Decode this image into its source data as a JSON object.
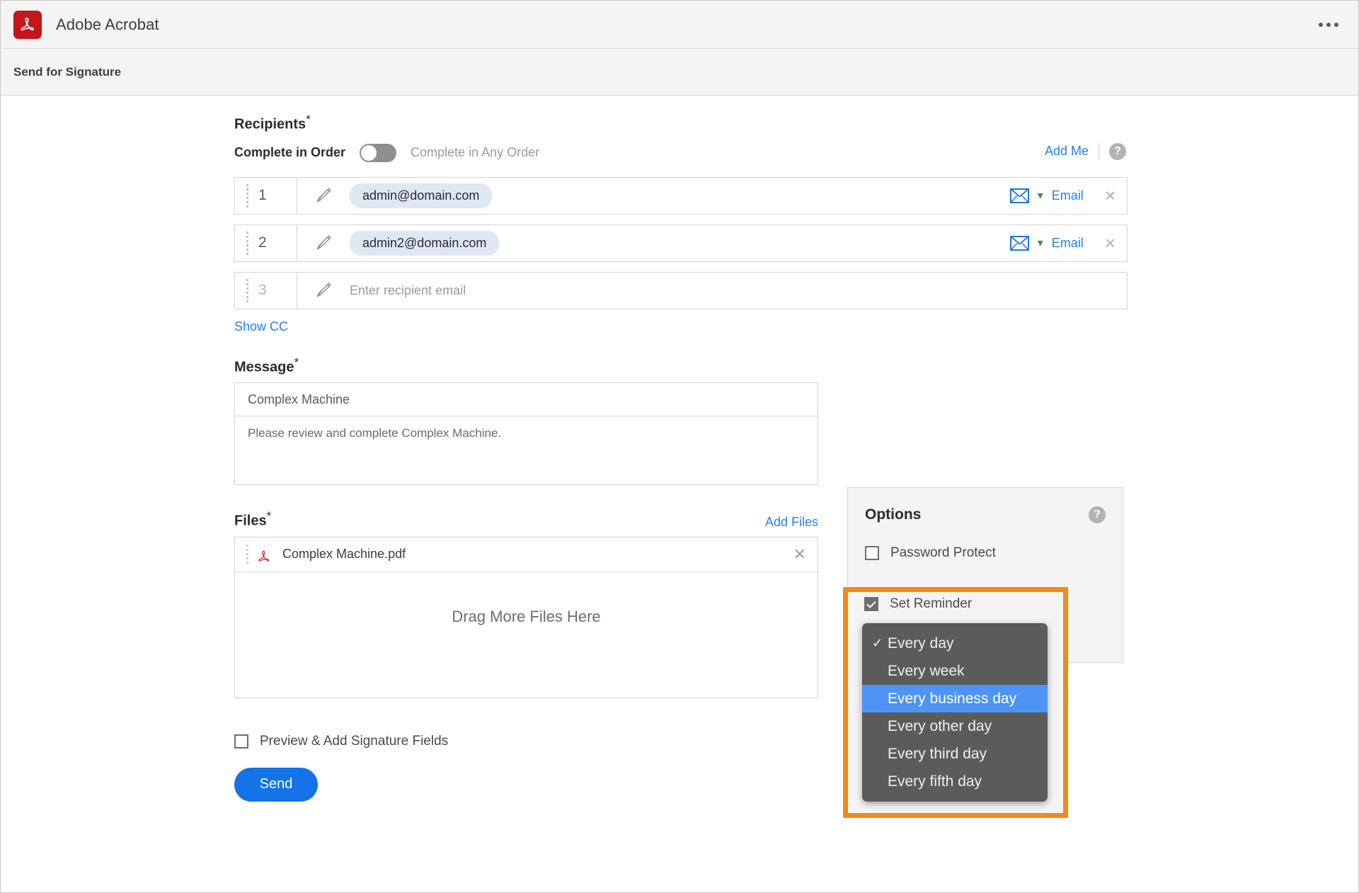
{
  "titlebar": {
    "app_name": "Adobe Acrobat",
    "logo_icon": "acrobat-logo-icon",
    "overflow_icon": "ellipsis-menu-icon"
  },
  "subheader": {
    "title": "Send for Signature"
  },
  "recipients": {
    "section_label": "Recipients",
    "required_mark": "*",
    "toggle": {
      "label_on": "Complete in Order",
      "label_off": "Complete in Any Order",
      "state": "off"
    },
    "add_me_label": "Add Me",
    "help_label": "?",
    "rows": [
      {
        "number": "1",
        "email": "admin@domain.com",
        "method_label": "Email",
        "method_icon": "envelope-icon",
        "pen_icon": "signature-pen-icon",
        "remove_label": "×"
      },
      {
        "number": "2",
        "email": "admin2@domain.com",
        "method_label": "Email",
        "method_icon": "envelope-icon",
        "pen_icon": "signature-pen-icon",
        "remove_label": "×"
      }
    ],
    "empty_row": {
      "number": "3",
      "placeholder": "Enter recipient email",
      "pen_icon": "signature-pen-icon"
    },
    "show_cc_label": "Show CC"
  },
  "message": {
    "section_label": "Message",
    "required_mark": "*",
    "subject_value": "Complex Machine",
    "body_value": "Please review and complete Complex Machine."
  },
  "files": {
    "section_label": "Files",
    "required_mark": "*",
    "add_files_label": "Add Files",
    "items": [
      {
        "name": "Complex Machine.pdf",
        "icon": "pdf-file-icon",
        "remove_label": "✕"
      }
    ],
    "dropzone_label": "Drag More Files Here"
  },
  "footer": {
    "preview_checkbox_label": "Preview & Add Signature Fields",
    "preview_checked": false,
    "send_label": "Send"
  },
  "options": {
    "title": "Options",
    "help_label": "?",
    "items": [
      {
        "label": "Password Protect",
        "checked": false
      },
      {
        "label": "Set Reminder",
        "checked": true
      }
    ]
  },
  "reminder_dropdown": {
    "open": true,
    "checked_value": "Every day",
    "highlighted_value": "Every business day",
    "check_glyph": "✓",
    "options": [
      {
        "label": "Every day",
        "checked": true,
        "highlighted": false
      },
      {
        "label": "Every week",
        "checked": false,
        "highlighted": false
      },
      {
        "label": "Every business day",
        "checked": false,
        "highlighted": true
      },
      {
        "label": "Every other day",
        "checked": false,
        "highlighted": false
      },
      {
        "label": "Every third day",
        "checked": false,
        "highlighted": false
      },
      {
        "label": "Every fifth day",
        "checked": false,
        "highlighted": false
      }
    ]
  },
  "colors": {
    "accent_blue": "#1473e6",
    "link_blue": "#2680eb",
    "highlight_orange": "#f28b16",
    "menu_selection_blue": "#4e94f5",
    "acrobat_red": "#c4161c"
  }
}
